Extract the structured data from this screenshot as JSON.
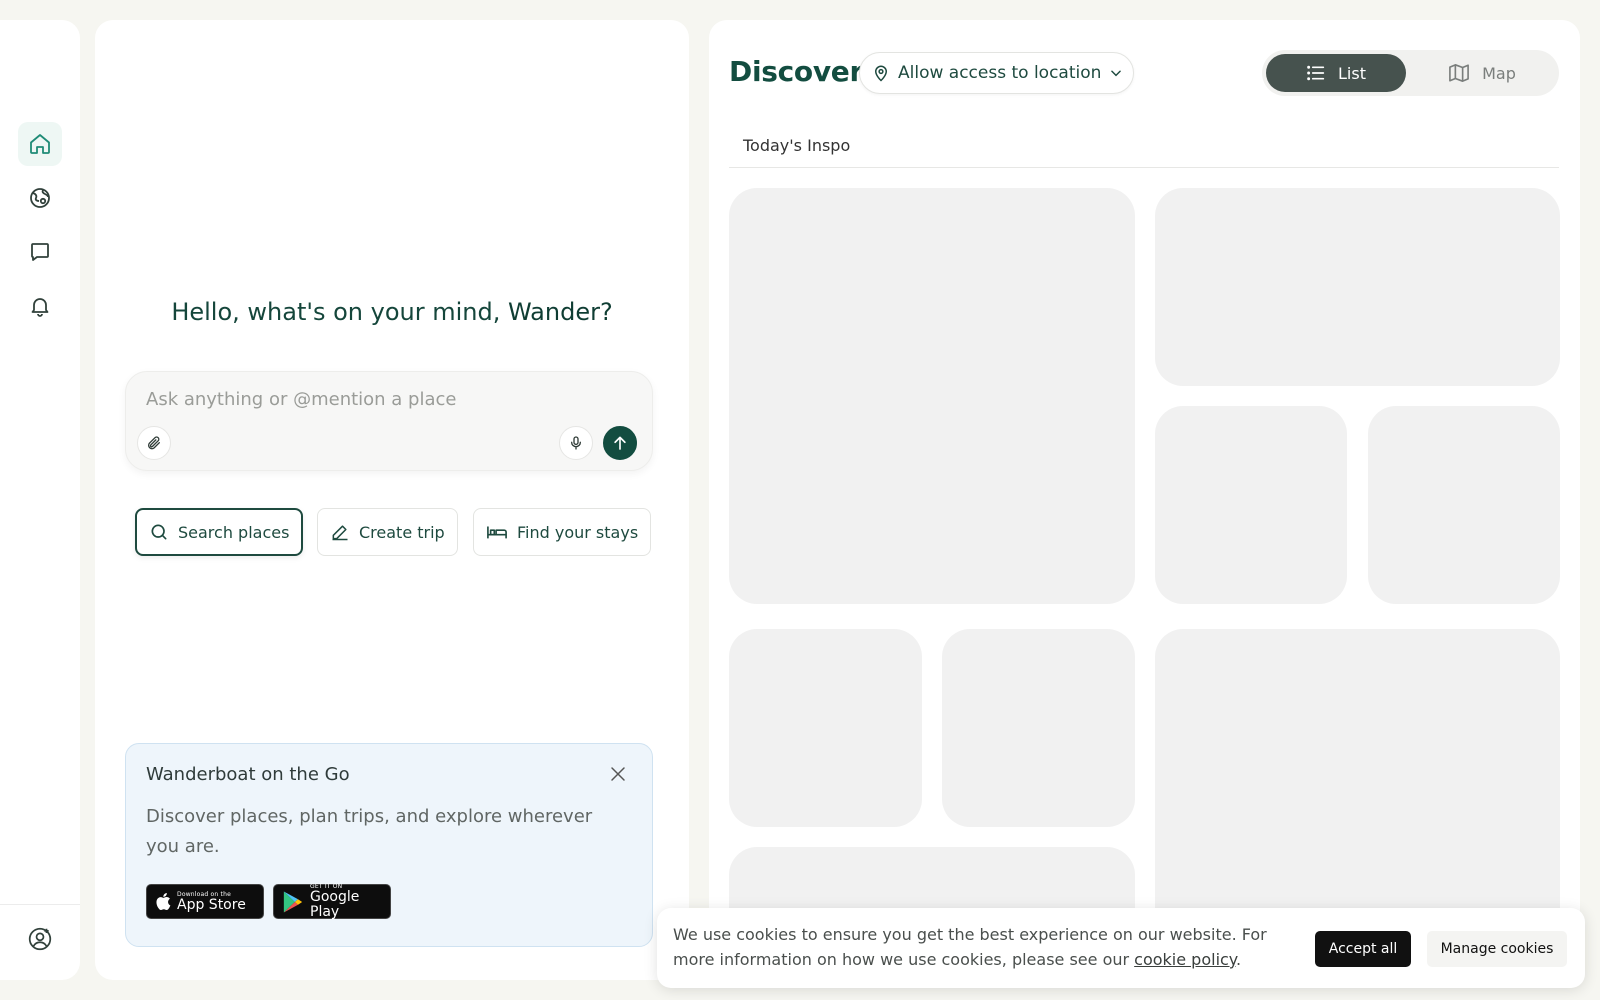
{
  "sidebar": {
    "items": [
      {
        "icon": "home-icon",
        "active": true
      },
      {
        "icon": "globe-icon",
        "active": false
      },
      {
        "icon": "chat-icon",
        "active": false
      },
      {
        "icon": "bell-icon",
        "active": false
      }
    ],
    "footer_icon": "user-add-icon"
  },
  "chat": {
    "greeting_prefix": "Hello, what's on your mind, ",
    "greeting_name": "Wander?",
    "input_placeholder": "Ask anything or @mention a place",
    "chips": {
      "search": "Search places",
      "create_trip": "Create trip",
      "stays": "Find your stays"
    },
    "promo": {
      "title": "Wanderboat on the Go",
      "text": "Discover places, plan trips, and explore wherever you are.",
      "app_store_small": "Download on the",
      "app_store_big": "App Store",
      "google_small": "GET IT ON",
      "google_big": "Google Play"
    }
  },
  "discover": {
    "title": "Discover",
    "location_label": "Allow access to location",
    "toggle": {
      "list": "List",
      "map": "Map",
      "selected": "List"
    },
    "section_tab": "Today's Inspo"
  },
  "cookie": {
    "text_before_link": "We use cookies to ensure you get the best experience on our website. For more information on how we use cookies, please see our ",
    "link": "cookie policy",
    "text_after_link": ".",
    "accept": "Accept all",
    "manage": "Manage cookies"
  },
  "colors": {
    "brand": "#134d40",
    "accent": "#1f8b76",
    "page_bg": "#f6f6f1",
    "skeleton": "#f1f1f1"
  }
}
